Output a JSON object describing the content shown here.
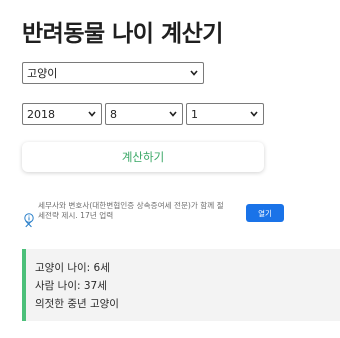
{
  "header": {
    "title": "반려동물 나이 계산기"
  },
  "form": {
    "species": {
      "value": "고양이"
    },
    "year": {
      "value": "2018"
    },
    "month": {
      "value": "8"
    },
    "day": {
      "value": "1"
    },
    "calculate_label": "계산하기"
  },
  "ad": {
    "text": "세무사와 변호사(대한변협인증 상속증여세 전문)가 함께 절세전략 제시. 17년 업력",
    "button_label": "열기",
    "icons": {
      "info": "info-icon",
      "close": "close-icon"
    }
  },
  "result": {
    "pet_age": "고양이 나이: 6세",
    "human_age": "사람 나이: 37세",
    "stage": "의젓한 중년 고양이"
  },
  "colors": {
    "accent_green": "#3aa866",
    "result_border": "#4cc07a",
    "ad_button": "#1a73e8"
  }
}
